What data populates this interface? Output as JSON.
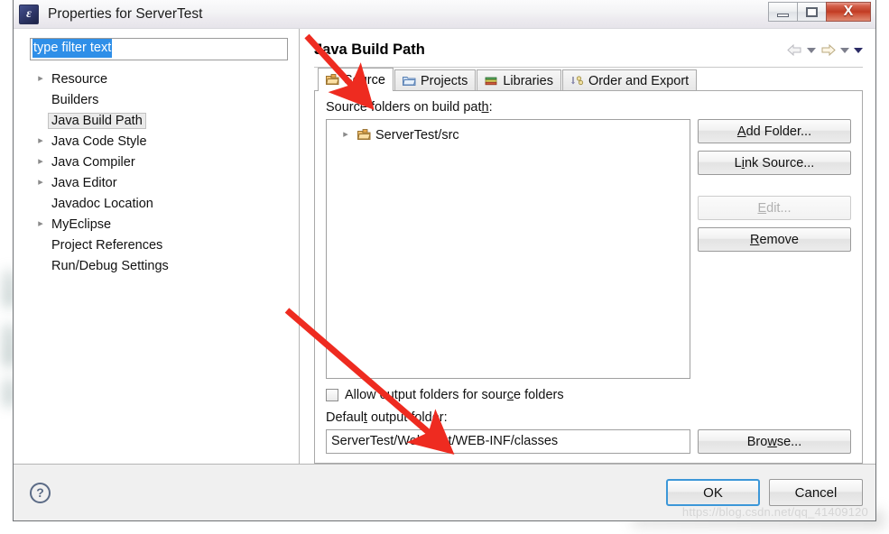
{
  "window": {
    "title": "Properties for ServerTest",
    "app_icon": "eclipse-app-icon",
    "controls": {
      "minimize": "minimize-button",
      "maximize": "restore-button",
      "close": "X"
    }
  },
  "sidebar": {
    "filter": {
      "value": "type filter text",
      "placeholder": "type filter text",
      "selected": true
    },
    "items": [
      {
        "label": "Resource",
        "expandable": true,
        "selected": false
      },
      {
        "label": "Builders",
        "expandable": false,
        "selected": false
      },
      {
        "label": "Java Build Path",
        "expandable": false,
        "selected": true
      },
      {
        "label": "Java Code Style",
        "expandable": true,
        "selected": false
      },
      {
        "label": "Java Compiler",
        "expandable": true,
        "selected": false
      },
      {
        "label": "Java Editor",
        "expandable": true,
        "selected": false
      },
      {
        "label": "Javadoc Location",
        "expandable": false,
        "selected": false
      },
      {
        "label": "MyEclipse",
        "expandable": true,
        "selected": false
      },
      {
        "label": "Project References",
        "expandable": false,
        "selected": false
      },
      {
        "label": "Run/Debug Settings",
        "expandable": false,
        "selected": false
      }
    ]
  },
  "page": {
    "title": "Java Build Path",
    "nav": {
      "back": "back-arrow",
      "back_menu": "back-dropdown",
      "forward": "forward-arrow",
      "forward_menu": "forward-dropdown",
      "more": "more-dropdown"
    },
    "tabs": [
      {
        "label": "Source",
        "icon": "source-folder-icon",
        "active": true
      },
      {
        "label": "Projects",
        "icon": "open-folder-icon",
        "active": false
      },
      {
        "label": "Libraries",
        "icon": "books-icon",
        "active": false
      },
      {
        "label": "Order and Export",
        "icon": "order-export-icon",
        "active": false
      }
    ],
    "source_tab": {
      "list_label_pre": "Source folders on build pat",
      "list_label_mnemonic": "h",
      "list_label_post": ":",
      "entries": [
        {
          "label": "ServerTest/src",
          "icon": "source-folder-icon",
          "expandable": true
        }
      ],
      "buttons": [
        {
          "label_pre": "",
          "mnemonic": "A",
          "label_post": "dd Folder...",
          "disabled": false,
          "name": "add-folder-button"
        },
        {
          "label_pre": "L",
          "mnemonic": "i",
          "label_post": "nk Source...",
          "disabled": false,
          "name": "link-source-button"
        },
        {
          "label_pre": "",
          "mnemonic": "E",
          "label_post": "dit...",
          "disabled": true,
          "name": "edit-button"
        },
        {
          "label_pre": "",
          "mnemonic": "R",
          "label_post": "emove",
          "disabled": false,
          "name": "remove-button"
        }
      ],
      "allow_output": {
        "checked": false,
        "label_pre": "Allow output folders for sour",
        "label_mnemonic": "c",
        "label_post": "e folders"
      },
      "default_output": {
        "label_pre": "Defaul",
        "label_mnemonic": "t",
        "label_post": " output folder:",
        "value": "ServerTest/WebRoot/WEB-INF/classes",
        "browse_pre": "Bro",
        "browse_mnemonic": "w",
        "browse_post": "se..."
      }
    }
  },
  "footer": {
    "help": "?",
    "ok": "OK",
    "cancel": "Cancel"
  },
  "watermark": "https://blog.csdn.net/qq_41409120",
  "colors": {
    "accent": "#2f8fe8",
    "default_button_border": "#3c97d8",
    "annotation_arrow": "#ee2b20",
    "close_button": "#bf3a22"
  }
}
